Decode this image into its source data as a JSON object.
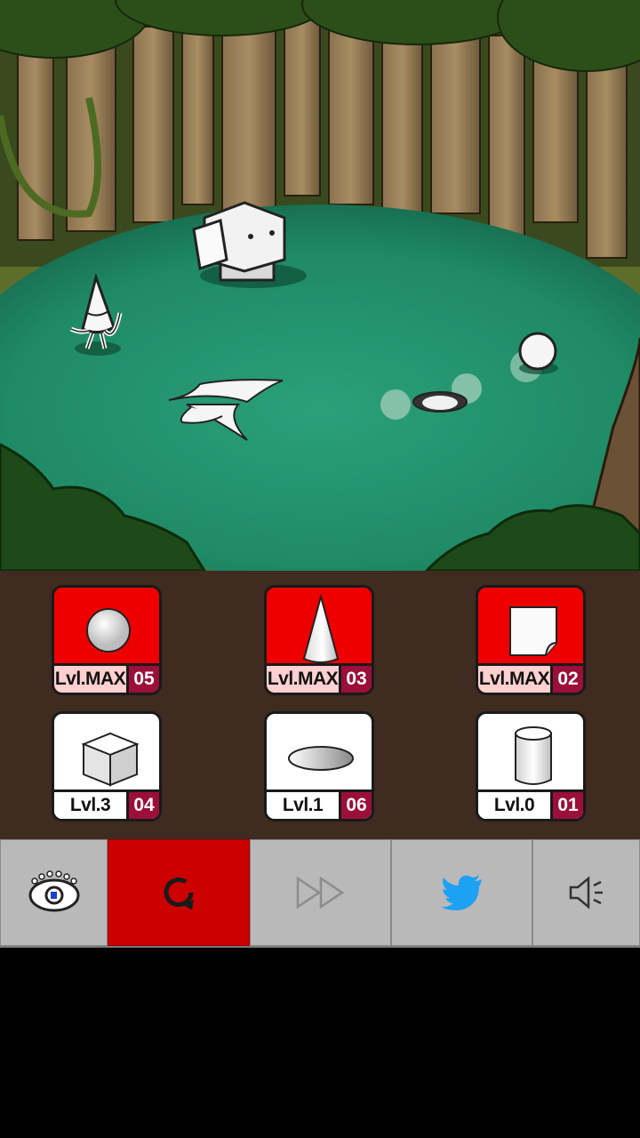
{
  "scene": {
    "description_icons": [
      "tree-icon",
      "cube-creature-icon",
      "cone-creature-icon",
      "bird-icon",
      "sphere-creature-icon",
      "disc-creature-icon"
    ]
  },
  "cards": [
    {
      "shape": "sphere",
      "level": "Lvl.MAX",
      "count": "05",
      "state": "maxed"
    },
    {
      "shape": "cone",
      "level": "Lvl.MAX",
      "count": "03",
      "state": "maxed"
    },
    {
      "shape": "paper",
      "level": "Lvl.MAX",
      "count": "02",
      "state": "maxed"
    },
    {
      "shape": "cube",
      "level": "Lvl.3",
      "count": "04",
      "state": "normal"
    },
    {
      "shape": "disc",
      "level": "Lvl.1",
      "count": "06",
      "state": "normal"
    },
    {
      "shape": "cylinder",
      "level": "Lvl.0",
      "count": "01",
      "state": "normal"
    }
  ],
  "toolbar": {
    "buttons": [
      {
        "name": "logo-button",
        "icon": "eye-logo-icon"
      },
      {
        "name": "restart-button",
        "icon": "restart-icon",
        "active": true
      },
      {
        "name": "fast-forward-button",
        "icon": "fast-forward-icon"
      },
      {
        "name": "twitter-button",
        "icon": "twitter-icon"
      },
      {
        "name": "sound-button",
        "icon": "speaker-icon"
      }
    ]
  },
  "colors": {
    "maxed_card": "#ee0000",
    "count_badge": "#9b0f3a",
    "panel_bg": "#3f2b1f",
    "active_button": "#cc0000",
    "twitter_blue": "#1da1f2"
  }
}
